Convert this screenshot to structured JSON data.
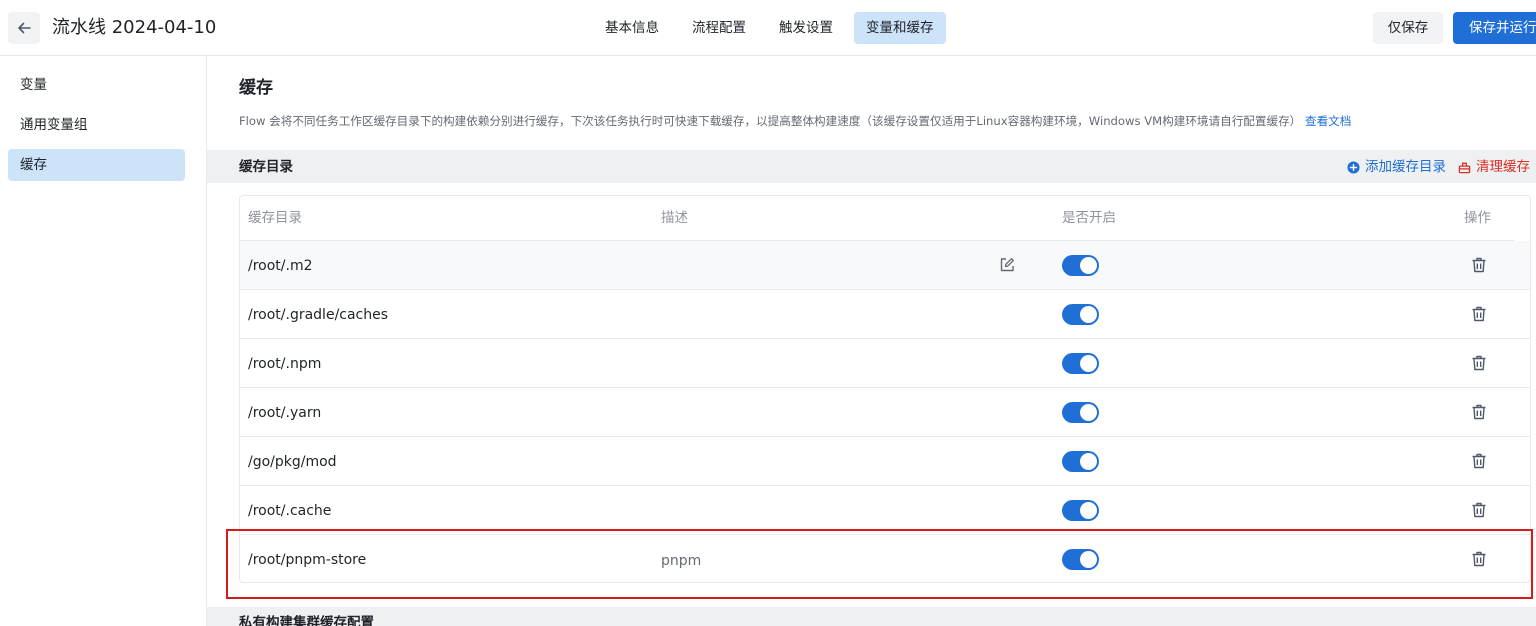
{
  "header": {
    "back_icon": "arrow-left-icon",
    "title": "流水线 2024-04-10",
    "tabs": [
      {
        "label": "基本信息",
        "active": false
      },
      {
        "label": "流程配置",
        "active": false
      },
      {
        "label": "触发设置",
        "active": false
      },
      {
        "label": "变量和缓存",
        "active": true
      }
    ],
    "save_only_label": "仅保存",
    "save_run_label": "保存并运行"
  },
  "sidebar": {
    "items": [
      {
        "label": "变量",
        "active": false
      },
      {
        "label": "通用变量组",
        "active": false
      },
      {
        "label": "缓存",
        "active": true
      }
    ]
  },
  "main": {
    "title": "缓存",
    "description": "Flow 会将不同任务工作区缓存目录下的构建依赖分别进行缓存，下次该任务执行时可快速下载缓存，以提高整体构建速度（该缓存设置仅适用于Linux容器构建环境，Windows VM构建环境请自行配置缓存）",
    "doc_link": "查看文档",
    "cache_group": {
      "title": "缓存目录",
      "add_label": "添加缓存目录",
      "clear_label": "清理缓存"
    },
    "table": {
      "columns": [
        "缓存目录",
        "描述",
        "是否开启",
        "操作"
      ],
      "rows": [
        {
          "path": "/root/.m2",
          "description": "",
          "enabled": true
        },
        {
          "path": "/root/.gradle/caches",
          "description": "",
          "enabled": true
        },
        {
          "path": "/root/.npm",
          "description": "",
          "enabled": true
        },
        {
          "path": "/root/.yarn",
          "description": "",
          "enabled": true
        },
        {
          "path": "/go/pkg/mod",
          "description": "",
          "enabled": true
        },
        {
          "path": "/root/.cache",
          "description": "",
          "enabled": true
        },
        {
          "path": "/root/pnpm-store",
          "description": "pnpm",
          "enabled": true
        }
      ]
    },
    "private_group": {
      "title": "私有构建集群缓存配置"
    }
  },
  "colors": {
    "accent": "#1f6fd6",
    "active_bg": "#cde3f9",
    "danger": "#d93026",
    "highlight_border": "#d71a1a"
  }
}
